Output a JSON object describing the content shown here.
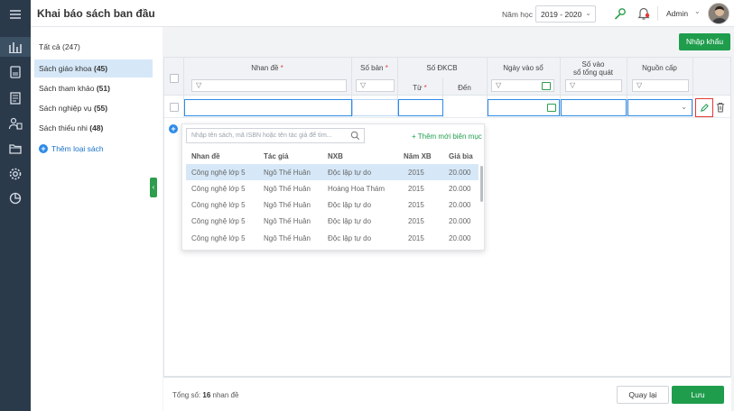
{
  "header": {
    "title": "Khai báo sách ban đầu",
    "school_year_label": "Năm học",
    "school_year_value": "2019 - 2020",
    "user": "Admin"
  },
  "categories": {
    "all_label": "Tất cả",
    "all_count": "(247)",
    "items": [
      {
        "label": "Sách giáo khoa",
        "count": "(45)"
      },
      {
        "label": "Sách tham khảo",
        "count": "(51)"
      },
      {
        "label": "Sách nghiệp vụ",
        "count": "(55)"
      },
      {
        "label": "Sách thiếu nhi",
        "count": "(48)"
      }
    ],
    "add_label": "Thêm loại sách"
  },
  "toolbar": {
    "import_label": "Nhập khẩu"
  },
  "table": {
    "headers": {
      "title": "Nhan đề",
      "copies": "Số bản",
      "dkcb": "Số ĐKCB",
      "from": "Từ",
      "to": "Đến",
      "date_in": "Ngày vào sổ",
      "ledger_line1": "Số vào",
      "ledger_line2": "sổ tổng quát",
      "source": "Nguồn cấp"
    },
    "required_mark": "*"
  },
  "dropdown": {
    "search_placeholder": "Nhập tên sách, mã ISBN hoặc tên tác giả để tìm...",
    "add_new_label": "+ Thêm mới biên mục",
    "columns": [
      "Nhan đề",
      "Tác giả",
      "NXB",
      "Năm XB",
      "Giá bìa"
    ],
    "rows": [
      [
        "Công nghệ lớp 5",
        "Ngô Thế Huân",
        "Độc lập tự do",
        "2015",
        "20.000"
      ],
      [
        "Công nghệ lớp 5",
        "Ngô Thế Huân",
        "Hoàng Hoa Thám",
        "2015",
        "20.000"
      ],
      [
        "Công nghệ lớp 5",
        "Ngô Thế Huân",
        "Độc lập tự do",
        "2015",
        "20.000"
      ],
      [
        "Công nghệ lớp 5",
        "Ngô Thế Huân",
        "Độc lập tự do",
        "2015",
        "20.000"
      ],
      [
        "Công nghệ lớp 5",
        "Ngô Thế Huân",
        "Độc lập tự do",
        "2015",
        "20.000"
      ]
    ]
  },
  "footer": {
    "total_prefix": "Tổng số:",
    "total_count": "16",
    "total_suffix": "nhan đề",
    "back_label": "Quay lại",
    "save_label": "Lưu"
  },
  "colors": {
    "accent": "#1f9d4d",
    "selection": "#d6e8f8",
    "rail": "#2b3a4b",
    "link": "#2e8be6"
  }
}
